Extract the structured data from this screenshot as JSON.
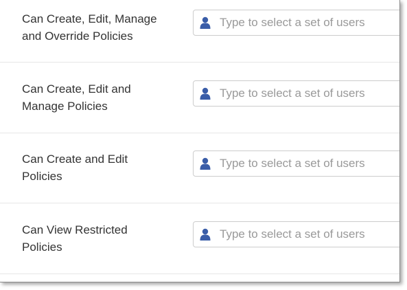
{
  "colors": {
    "icon": "#3a5da8",
    "label_text": "#333333",
    "placeholder_text": "#999999",
    "field_border": "#cccccc",
    "row_divider": "#e6e6e6"
  },
  "permissions": [
    {
      "label": "Can Create, Edit, Manage\nand Override Policies",
      "icon": "user-icon",
      "placeholder": "Type to select a set of users",
      "value": ""
    },
    {
      "label": "Can Create, Edit and\nManage Policies",
      "icon": "user-icon",
      "placeholder": "Type to select a set of users",
      "value": ""
    },
    {
      "label": "Can Create and Edit\nPolicies",
      "icon": "user-icon",
      "placeholder": "Type to select a set of users",
      "value": ""
    },
    {
      "label": "Can View Restricted\nPolicies",
      "icon": "user-icon",
      "placeholder": "Type to select a set of users",
      "value": ""
    }
  ]
}
